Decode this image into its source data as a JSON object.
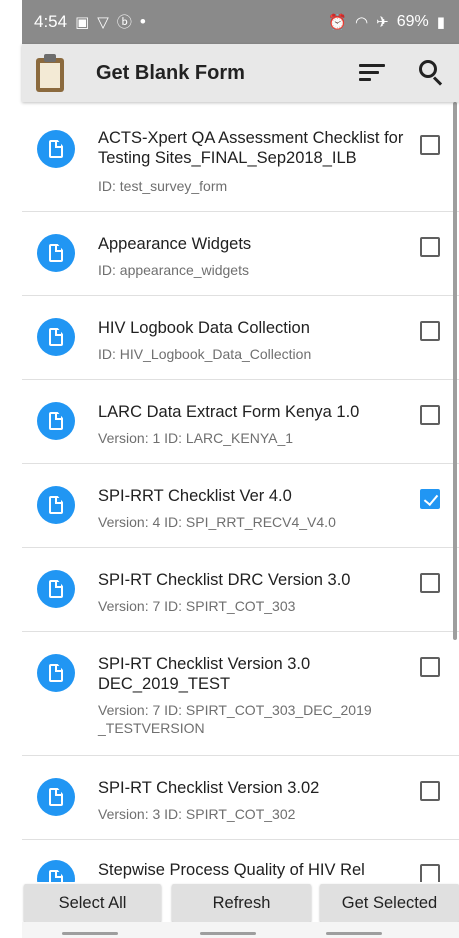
{
  "status_bar": {
    "time": "4:54",
    "left_icons": [
      "image-icon",
      "shield-icon",
      "circle-b-icon"
    ],
    "dot": "•",
    "battery": "69%"
  },
  "app_bar": {
    "title": "Get Blank Form"
  },
  "forms": [
    {
      "title": "ACTS-Xpert QA Assessment Checklist for Testing Sites_FINAL_Sep2018_ILB",
      "subtitle": "ID: test_survey_form",
      "checked": false
    },
    {
      "title": "Appearance Widgets",
      "subtitle": "ID: appearance_widgets",
      "checked": false
    },
    {
      "title": "HIV Logbook Data Collection",
      "subtitle": "ID: HIV_Logbook_Data_Collection",
      "checked": false
    },
    {
      "title": "LARC Data Extract Form Kenya 1.0",
      "subtitle": "Version: 1 ID: LARC_KENYA_1",
      "checked": false
    },
    {
      "title": "SPI-RRT Checklist Ver 4.0",
      "subtitle": "Version: 4 ID: SPI_RRT_RECV4_V4.0",
      "checked": true
    },
    {
      "title": "SPI-RT Checklist DRC Version 3.0",
      "subtitle": "Version: 7 ID: SPIRT_COT_303",
      "checked": false
    },
    {
      "title": "SPI-RT Checklist Version 3.0 DEC_2019_TEST",
      "subtitle": "Version: 7 ID: SPIRT_COT_303_DEC_2019 _TESTVERSION",
      "checked": false
    },
    {
      "title": "SPI-RT Checklist Version 3.02",
      "subtitle": "Version: 3 ID: SPIRT_COT_302",
      "checked": false
    },
    {
      "title": "Stepwise Process Quality of HIV Rel",
      "subtitle": "",
      "checked": false
    }
  ],
  "buttons": {
    "select_all": "Select All",
    "refresh": "Refresh",
    "get_selected": "Get Selected"
  },
  "colors": {
    "accent": "#2196f3",
    "status_bar": "#8a8a8a",
    "app_bar": "#e8e8e8",
    "button": "#e0e0e0"
  }
}
